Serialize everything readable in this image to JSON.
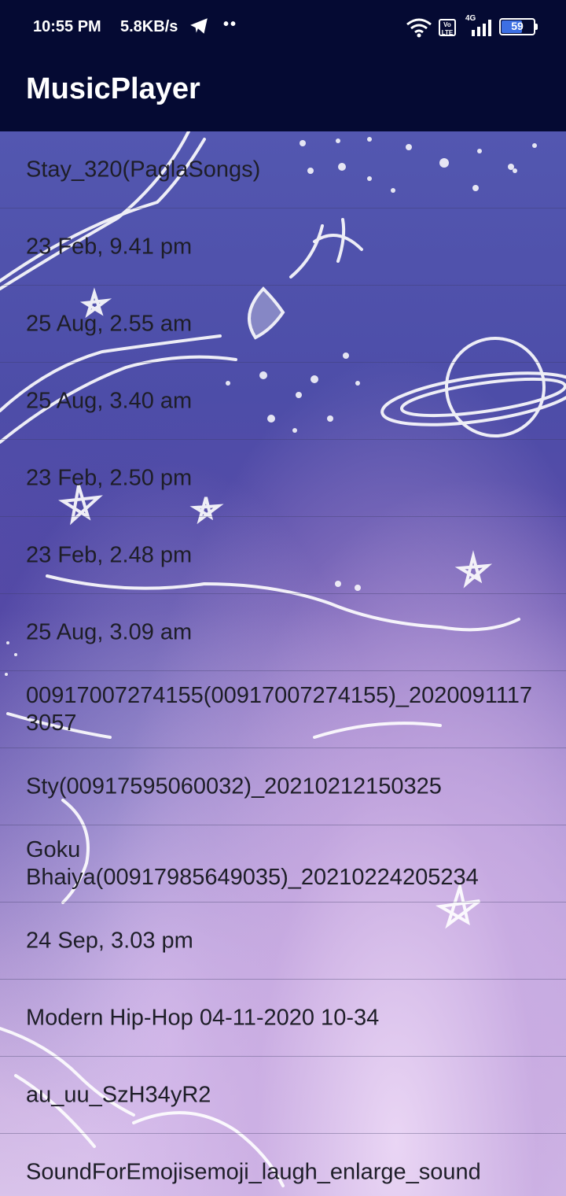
{
  "status_bar": {
    "time": "10:55 PM",
    "net_speed": "5.8KB/s",
    "more_dots": "••",
    "volte": "Vo LTE",
    "signal_label": "4G",
    "battery": "59"
  },
  "app_bar": {
    "title": "MusicPlayer"
  },
  "tracks": [
    {
      "title": "Stay_320(PaglaSongs)"
    },
    {
      "title": "23 Feb, 9.41 pm"
    },
    {
      "title": "25 Aug, 2.55 am"
    },
    {
      "title": "25 Aug, 3.40 am"
    },
    {
      "title": "23 Feb, 2.50 pm"
    },
    {
      "title": "23 Feb, 2.48 pm"
    },
    {
      "title": "25 Aug, 3.09 am"
    },
    {
      "title": "00917007274155(00917007274155)_20200911173057"
    },
    {
      "title": "Sty(00917595060032)_20210212150325"
    },
    {
      "title": "Goku Bhaiya(00917985649035)_20210224205234"
    },
    {
      "title": "24 Sep, 3.03 pm"
    },
    {
      "title": "Modern Hip-Hop 04-11-2020 10-34"
    },
    {
      "title": "au_uu_SzH34yR2"
    },
    {
      "title": "SoundForEmojisemoji_laugh_enlarge_sound"
    }
  ],
  "colors": {
    "bar_background": "#050a33",
    "text_dark": "#1e1e28",
    "battery_fill": "#3d6fe3"
  }
}
